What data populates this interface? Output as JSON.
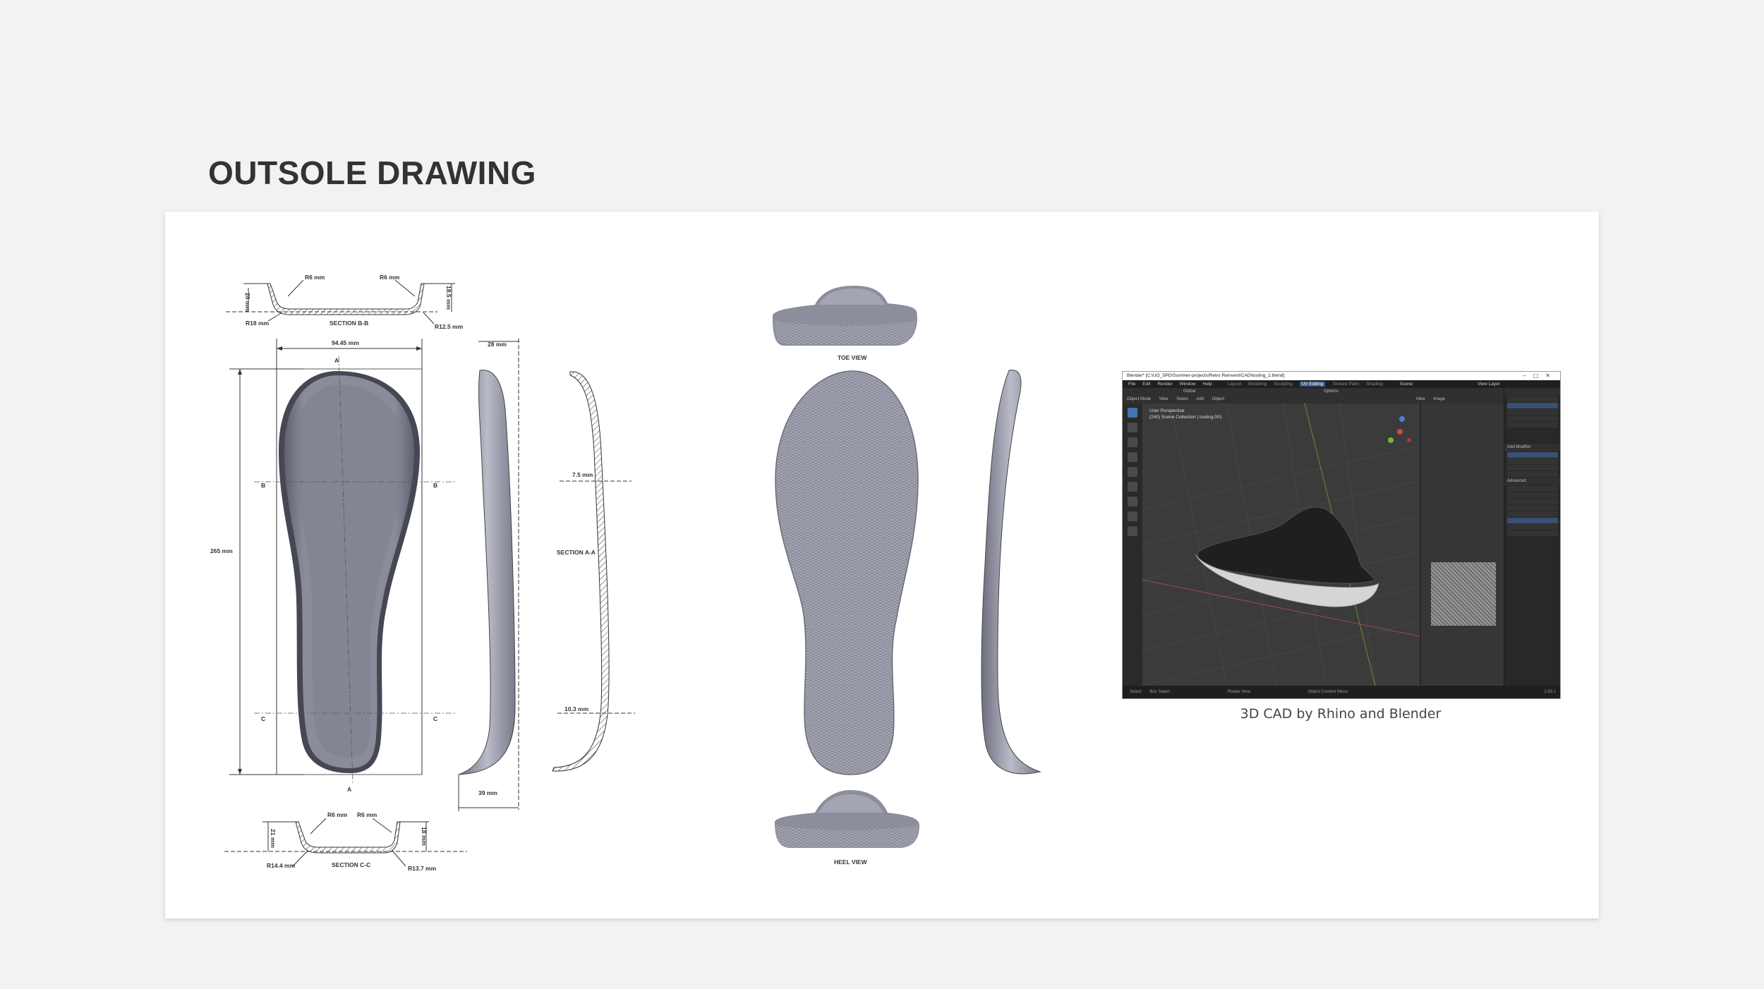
{
  "page": {
    "title": "OUTSOLE DRAWING"
  },
  "drawing": {
    "section_bb": {
      "label": "SECTION B-B",
      "r_top_left": "R6 mm",
      "r_top_right": "R6 mm",
      "r_bottom_left": "R18 mm",
      "r_bottom_right": "R12.5 mm",
      "h_left": "20 mm",
      "h_right": "18.5 mm"
    },
    "width_dim": "94.45 mm",
    "length_dim": "265 mm",
    "side_top_dim": "28 mm",
    "side_bottom_dim": "39 mm",
    "markers": {
      "a": "A",
      "b": "B",
      "c": "C"
    },
    "section_aa": {
      "label": "SECTION A-A",
      "thickness_top": "7.5 mm",
      "thickness_bottom": "10.3 mm"
    },
    "section_cc": {
      "label": "SECTION C-C",
      "r_top_left": "R6 mm",
      "r_top_right": "R6 mm",
      "r_bottom_left": "R14.4 mm",
      "r_bottom_right": "R13.7 mm",
      "h_left": "21 mm",
      "h_right": "18 mm"
    },
    "toe_view": "TOE VIEW",
    "heel_view": "HEEL VIEW"
  },
  "blender": {
    "title": "Blender* [C:\\UO_SPD\\Summer-projects\\Retro Reinvent\\CAD\\tooling_2.blend]",
    "menu": [
      "File",
      "Edit",
      "Render",
      "Window",
      "Help"
    ],
    "workspaces": [
      "Layout",
      "Modeling",
      "Sculpting",
      "UV Editing",
      "Texture Paint",
      "Shading"
    ],
    "active_workspace": "UV Editing",
    "scene": "Scene",
    "view_layer": "View Layer",
    "mode": "Object Mode",
    "view_menu": [
      "View",
      "Select",
      "Add",
      "Object"
    ],
    "orientation": "Global",
    "options": "Options",
    "viewport_line1": "User Perspective",
    "viewport_line2": "(240) Scene Collection | tooling.001",
    "image_menu": [
      "View",
      "Image"
    ],
    "add_modifier": "Add Modifier",
    "advanced": "Advanced",
    "status": [
      "Select",
      "Box Select",
      "Rotate View",
      "Object Context Menu"
    ],
    "version": "2.93.1"
  },
  "caption": "3D CAD by Rhino and Blender",
  "colors": {
    "title": "#333333",
    "sole": "#8a8c9a",
    "sole_dark": "#5f6170",
    "card": "#ffffff",
    "background": "#f2f2f2"
  }
}
